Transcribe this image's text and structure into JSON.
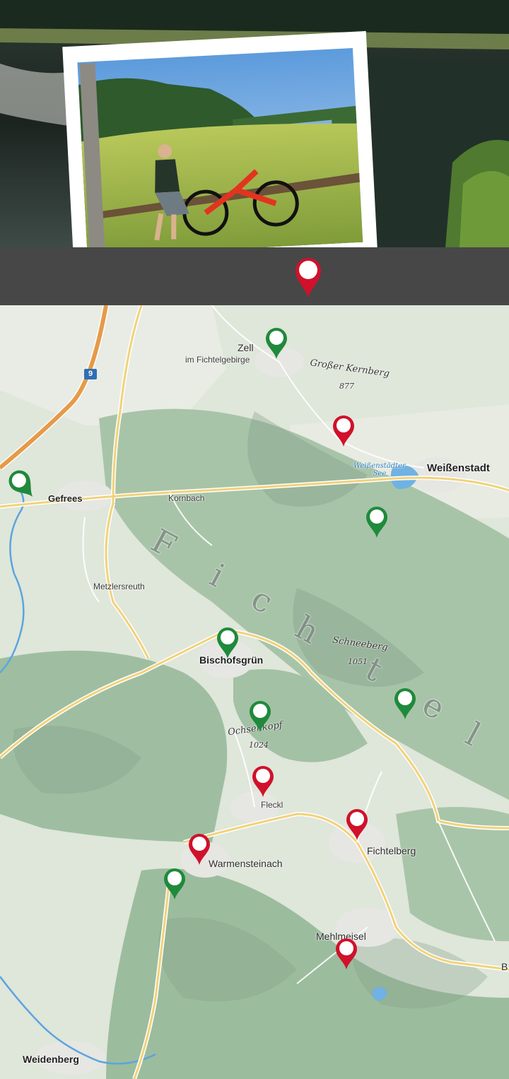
{
  "map": {
    "places": {
      "zell": "Zell",
      "zell_sub": "im Fichtelgebirge",
      "weissenstadt": "Weißenstadt",
      "gefrees": "Gefrees",
      "kornbach": "Kornbach",
      "metzlersreuth": "Metzlersreuth",
      "bischofsgruen": "Bischofsgrün",
      "fleckl": "Fleckl",
      "fichtelberg": "Fichtelberg",
      "warmensteinach": "Warmensteinach",
      "mehlmeisel": "Mehlmeisel",
      "weidenberg": "Weidenberg",
      "edge_b": "B"
    },
    "peaks": {
      "kernberg_name": "Großer Kernberg",
      "kernberg_height": "877",
      "schneeberg_name": "Schneeberg",
      "schneeberg_height": "1051",
      "ochsenkopf_name": "Ochsenkopf",
      "ochsenkopf_height": "1024"
    },
    "lake": {
      "line1": "Weißenstädter",
      "line2": "See"
    },
    "range_letters": [
      "F",
      "i",
      "c",
      "h",
      "t",
      "e",
      "l"
    ],
    "route_number": "9"
  },
  "colors": {
    "pin_red": "#d0112b",
    "pin_green": "#1f8a3b",
    "header_bar": "#474747"
  }
}
